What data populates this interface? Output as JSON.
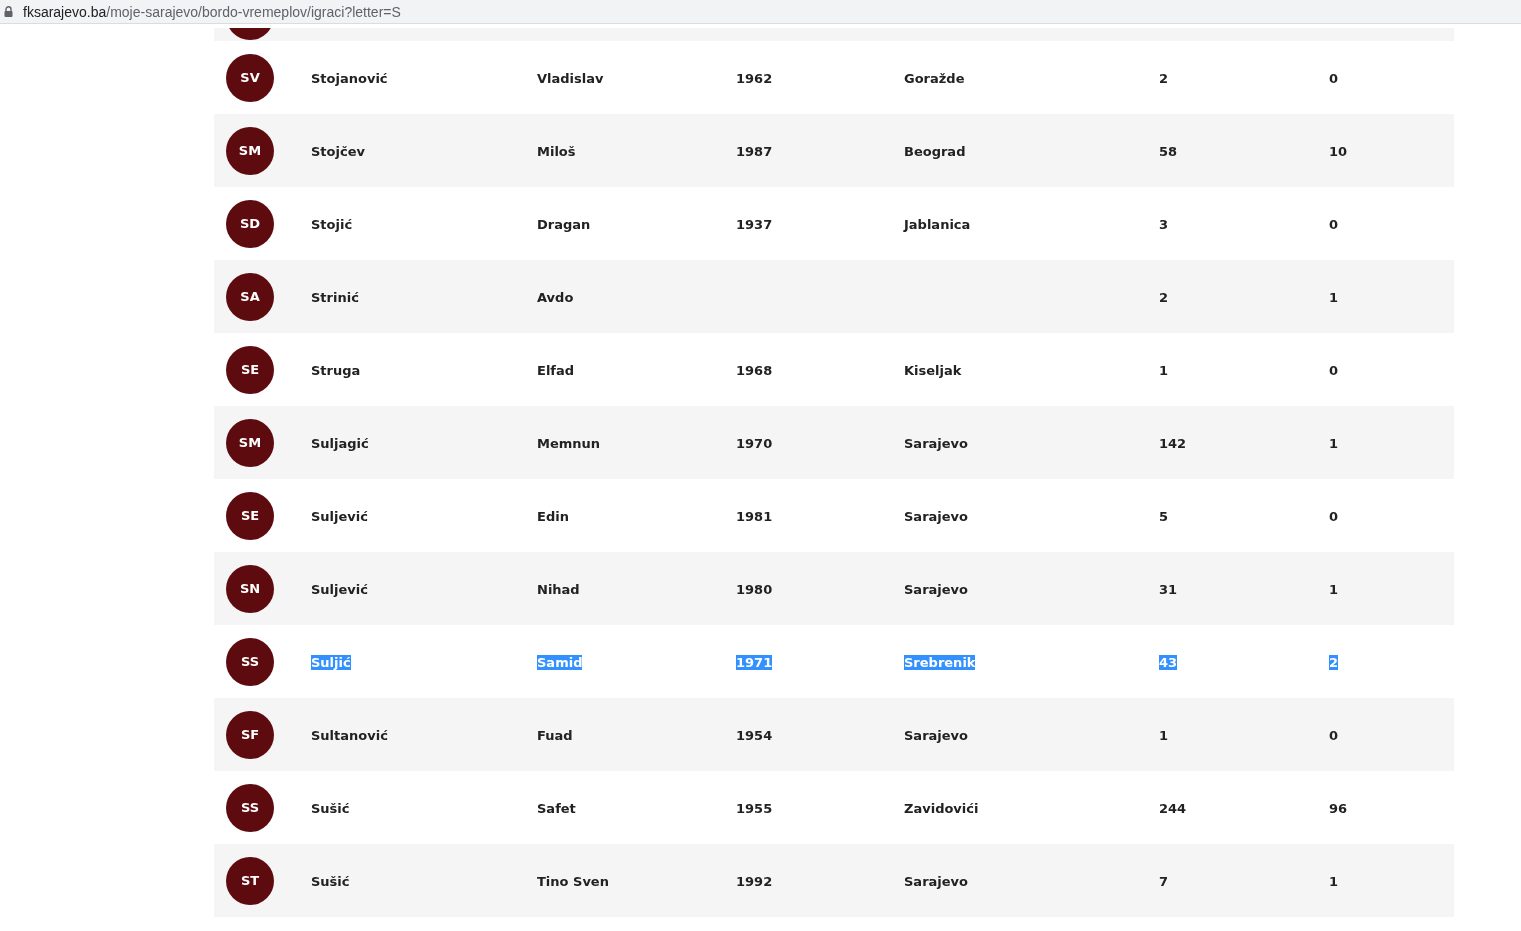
{
  "address_bar": {
    "domain": "fksarajevo.ba",
    "path": "/moje-sarajevo/bordo-vremeplov/igraci?letter=S"
  },
  "rows": [
    {
      "initials": "SV",
      "surname": "Stojanović",
      "name": "Vladislav",
      "year": "1962",
      "city": "Goražde",
      "apps": "2",
      "goals": "0",
      "text_selected": false
    },
    {
      "initials": "SM",
      "surname": "Stojčev",
      "name": "Miloš",
      "year": "1987",
      "city": "Beograd",
      "apps": "58",
      "goals": "10",
      "text_selected": false
    },
    {
      "initials": "SD",
      "surname": "Stojić",
      "name": "Dragan",
      "year": "1937",
      "city": "Jablanica",
      "apps": "3",
      "goals": "0",
      "text_selected": false
    },
    {
      "initials": "SA",
      "surname": "Strinić",
      "name": "Avdo",
      "year": "",
      "city": "",
      "apps": "2",
      "goals": "1",
      "text_selected": false
    },
    {
      "initials": "SE",
      "surname": "Struga",
      "name": "Elfad",
      "year": "1968",
      "city": "Kiseljak",
      "apps": "1",
      "goals": "0",
      "text_selected": false
    },
    {
      "initials": "SM",
      "surname": "Suljagić",
      "name": "Memnun",
      "year": "1970",
      "city": "Sarajevo",
      "apps": "142",
      "goals": "1",
      "text_selected": false
    },
    {
      "initials": "SE",
      "surname": "Suljević",
      "name": "Edin",
      "year": "1981",
      "city": "Sarajevo",
      "apps": "5",
      "goals": "0",
      "text_selected": false
    },
    {
      "initials": "SN",
      "surname": "Suljević",
      "name": "Nihad",
      "year": "1980",
      "city": "Sarajevo",
      "apps": "31",
      "goals": "1",
      "text_selected": false
    },
    {
      "initials": "SS",
      "surname": "Suljić",
      "name": "Samid",
      "year": "1971",
      "city": "Srebrenik",
      "apps": "43",
      "goals": "2",
      "text_selected": true
    },
    {
      "initials": "SF",
      "surname": "Sultanović",
      "name": "Fuad",
      "year": "1954",
      "city": "Sarajevo",
      "apps": "1",
      "goals": "0",
      "text_selected": false
    },
    {
      "initials": "SS",
      "surname": "Sušić",
      "name": "Safet",
      "year": "1955",
      "city": "Zavidovići",
      "apps": "244",
      "goals": "96",
      "text_selected": false
    },
    {
      "initials": "ST",
      "surname": "Sušić",
      "name": "Tino Sven",
      "year": "1992",
      "city": "Sarajevo",
      "apps": "7",
      "goals": "1",
      "text_selected": false
    }
  ]
}
